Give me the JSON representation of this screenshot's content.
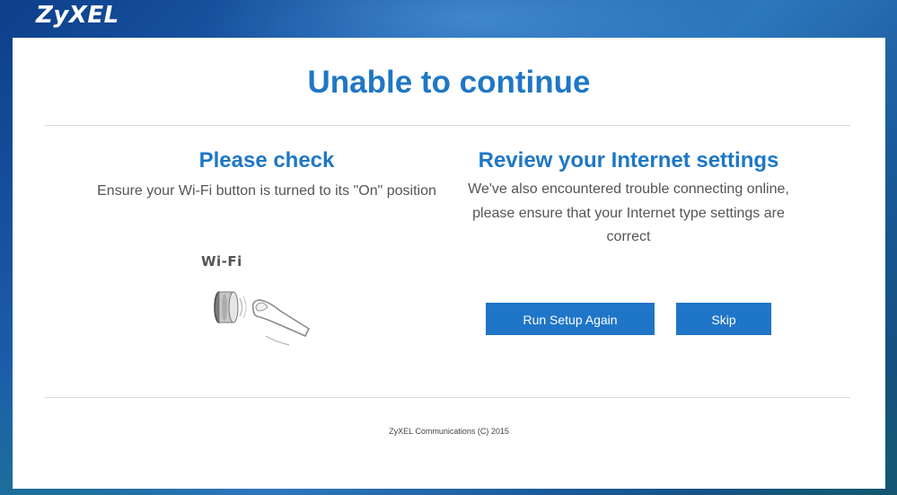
{
  "header": {
    "logo_text": "ZyXEL"
  },
  "main": {
    "title": "Unable to continue",
    "left": {
      "heading": "Please check",
      "text": "Ensure your Wi-Fi button is turned to its \"On\" position",
      "wifi_label": "Wi-Fi",
      "illustration_icon": "wifi-button-press-icon"
    },
    "right": {
      "heading": "Review your Internet settings",
      "text": "We've also encountered trouble connecting online, please ensure that your Internet type settings are correct",
      "buttons": {
        "run_setup": "Run Setup Again",
        "skip": "Skip"
      }
    }
  },
  "footer": {
    "text": "ZyXEL Communications (C) 2015"
  },
  "colors": {
    "accent": "#1f77c5",
    "button": "#1f75c7",
    "body_text": "#555555",
    "background_blue": "#1f5fae"
  }
}
